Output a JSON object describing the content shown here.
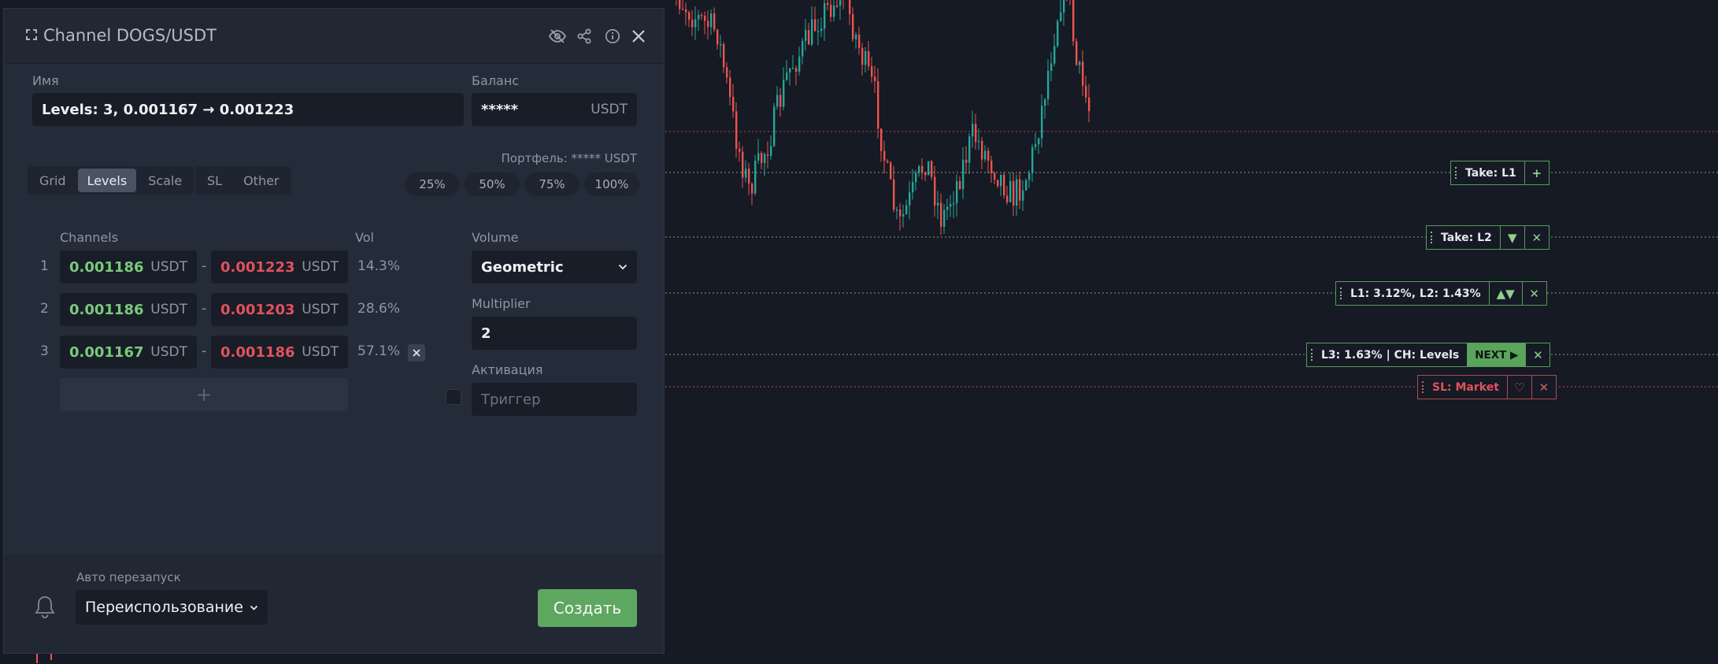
{
  "panel": {
    "title": "Channel DOGS/USDT",
    "name_label": "Имя",
    "name_value": "Levels: 3, 0.001167 → 0.001223",
    "balance_label": "Баланс",
    "balance_value": "*****",
    "balance_unit": "USDT",
    "portfolio_text": "Портфель: ***** USDT",
    "mode_tabs": [
      {
        "label": "Grid",
        "active": false
      },
      {
        "label": "Levels",
        "active": true
      },
      {
        "label": "Scale",
        "active": false
      }
    ],
    "extra_tabs": [
      {
        "label": "SL"
      },
      {
        "label": "Other"
      }
    ],
    "percent_buttons": [
      "25%",
      "50%",
      "75%",
      "100%"
    ],
    "channels_label": "Channels",
    "vol_label": "Vol",
    "channels": [
      {
        "index": "1",
        "low": "0.001186",
        "low_unit": "USDT",
        "sep": "-",
        "high": "0.001223",
        "high_unit": "USDT",
        "vol": "14.3%"
      },
      {
        "index": "2",
        "low": "0.001186",
        "low_unit": "USDT",
        "sep": "-",
        "high": "0.001203",
        "high_unit": "USDT",
        "vol": "28.6%"
      },
      {
        "index": "3",
        "low": "0.001167",
        "low_unit": "USDT",
        "sep": "-",
        "high": "0.001186",
        "high_unit": "USDT",
        "vol": "57.1%"
      }
    ],
    "add_symbol": "+",
    "volume_label": "Volume",
    "volume_value": "Geometric",
    "multiplier_label": "Multiplier",
    "multiplier_value": "2",
    "activation_label": "Активация",
    "activation_placeholder": "Триггер",
    "auto_restart_label": "Авто перезапуск",
    "auto_restart_value": "Переиспользование",
    "create_label": "Создать"
  },
  "order_labels": [
    {
      "text": "Take: L1",
      "buttons": [
        "+"
      ],
      "color": "green"
    },
    {
      "text": "Take: L2",
      "buttons": [
        "▼",
        "✕"
      ],
      "color": "green"
    },
    {
      "text": "L1: 3.12%, L2: 1.43%",
      "buttons": [
        "▲▼",
        "✕"
      ],
      "color": "green"
    },
    {
      "text": "L3: 1.63% | CH: Levels",
      "next": "NEXT ▶",
      "buttons": [
        "✕"
      ],
      "color": "green"
    },
    {
      "text": "SL: Market",
      "buttons": [
        "♡",
        "✕"
      ],
      "color": "red"
    }
  ],
  "colors": {
    "up": "#26a69a",
    "down": "#ef5350",
    "accent_green": "#5ea760",
    "background": "#151a24",
    "panel": "#252c39"
  }
}
